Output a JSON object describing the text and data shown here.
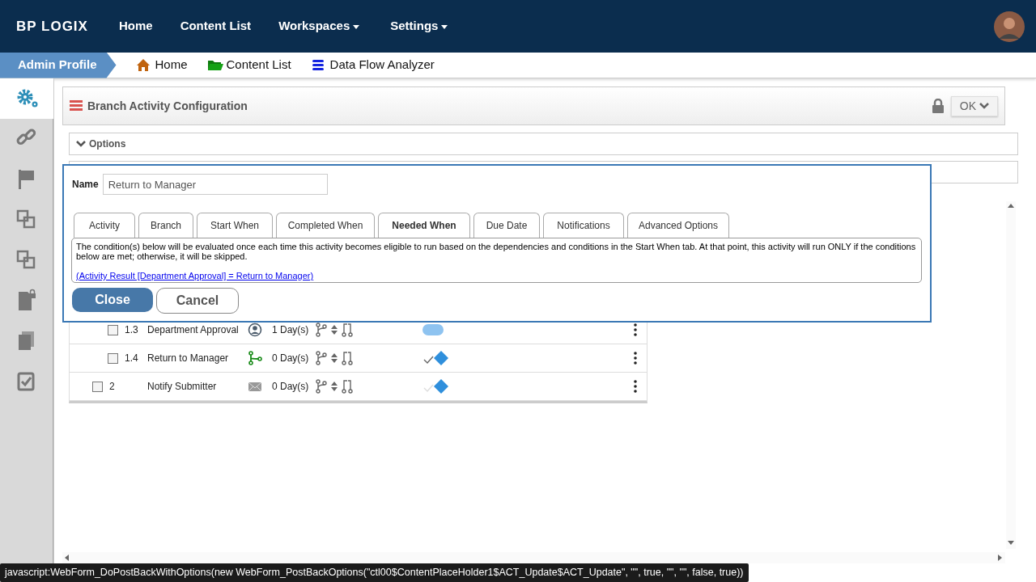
{
  "navbar": {
    "logo": "BP LOGIX",
    "items": [
      {
        "label": "Home",
        "dropdown": false
      },
      {
        "label": "Content List",
        "dropdown": false
      },
      {
        "label": "Workspaces",
        "dropdown": true
      },
      {
        "label": "Settings",
        "dropdown": true
      }
    ]
  },
  "breadcrumb": {
    "profile": "Admin Profile",
    "links": [
      {
        "label": "Home",
        "kind": "home"
      },
      {
        "label": "Content List",
        "kind": "folder"
      },
      {
        "label": "Data Flow Analyzer",
        "kind": "database"
      }
    ]
  },
  "sidebar": {
    "items": [
      {
        "kind": "gears",
        "selected": true
      },
      {
        "kind": "link",
        "selected": false
      },
      {
        "kind": "flag",
        "selected": false
      },
      {
        "kind": "squares",
        "selected": false
      },
      {
        "kind": "squares",
        "selected": false
      },
      {
        "kind": "lockfile",
        "selected": false
      },
      {
        "kind": "pages",
        "selected": false
      },
      {
        "kind": "checkpage",
        "selected": false
      }
    ]
  },
  "header": {
    "title": "Branch Activity Configuration",
    "ok_button": "OK"
  },
  "panels": [
    {
      "label": "Options",
      "expanded": true
    }
  ],
  "rows": [
    {
      "number": "1.3",
      "name": "Department Approval",
      "kind": "user",
      "duration": "1 Day(s)",
      "checked": false,
      "nested": true,
      "status": {
        "kind": "running"
      }
    },
    {
      "number": "1.4",
      "name": "Return to Manager",
      "kind": "branch",
      "duration": "0 Day(s)",
      "checked": false,
      "nested": true,
      "status": {
        "kind": "complete"
      }
    },
    {
      "number": "2",
      "name": "Notify Submitter",
      "kind": "email",
      "duration": "0 Day(s)",
      "checked": false,
      "nested": false,
      "status": {
        "kind": "pending"
      }
    }
  ],
  "dialog": {
    "name_label": "Name",
    "name_value": "Return to Manager",
    "tabs": [
      {
        "label": "Activity",
        "selected": false
      },
      {
        "label": "Branch",
        "selected": false
      },
      {
        "label": "Start When",
        "selected": false
      },
      {
        "label": "Completed When",
        "selected": false
      },
      {
        "label": "Needed When",
        "selected": true
      },
      {
        "label": "Due Date",
        "selected": false
      },
      {
        "label": "Notifications",
        "selected": false
      },
      {
        "label": "Advanced Options",
        "selected": false
      }
    ],
    "description": "The condition(s) below will be evaluated once each time this activity becomes eligible to run based on the dependencies and conditions in the Start When tab. At that point, this activity will run ONLY if the conditions below are met; otherwise, it will be skipped.",
    "condition_link": "(Activity Result [Department Approval] = Return to Manager)",
    "buttons": [
      {
        "label": "Close",
        "kind": "primary"
      },
      {
        "label": "Cancel",
        "kind": "secondary"
      }
    ]
  },
  "status_tooltip": "javascript:WebForm_DoPostBackWithOptions(new WebForm_PostBackOptions(\"ctl00$ContentPlaceHolder1$ACT_Update$ACT_Update\", \"\", true, \"\", \"\", false, true))"
}
